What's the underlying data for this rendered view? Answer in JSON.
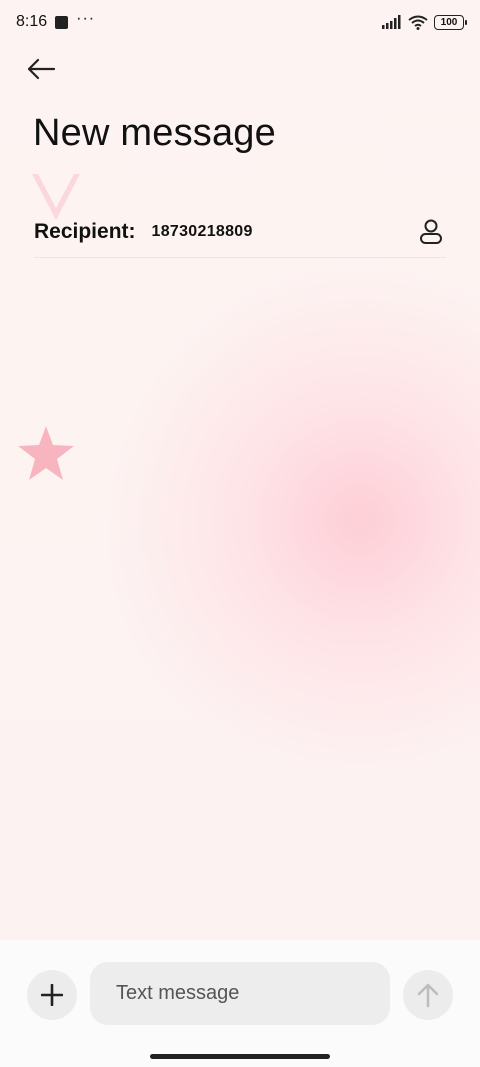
{
  "status_bar": {
    "time": "8:16",
    "dots": "···",
    "battery": "100",
    "icons": [
      "notification-square-icon",
      "signal-icon",
      "wifi-icon",
      "battery-icon"
    ]
  },
  "header": {
    "back_icon": "back-arrow-icon",
    "title": "New message"
  },
  "recipient": {
    "label": "Recipient:",
    "value": "18730218809",
    "contact_icon": "contact-person-icon"
  },
  "composer": {
    "add_icon": "plus-icon",
    "placeholder": "Text message",
    "value": "",
    "send_icon": "send-arrow-up-icon"
  },
  "colors": {
    "background": "#fdf3f2",
    "accent_pink": "#f7b6bf",
    "input_bg": "#ededed",
    "button_bg": "#ececec",
    "text": "#111111"
  }
}
